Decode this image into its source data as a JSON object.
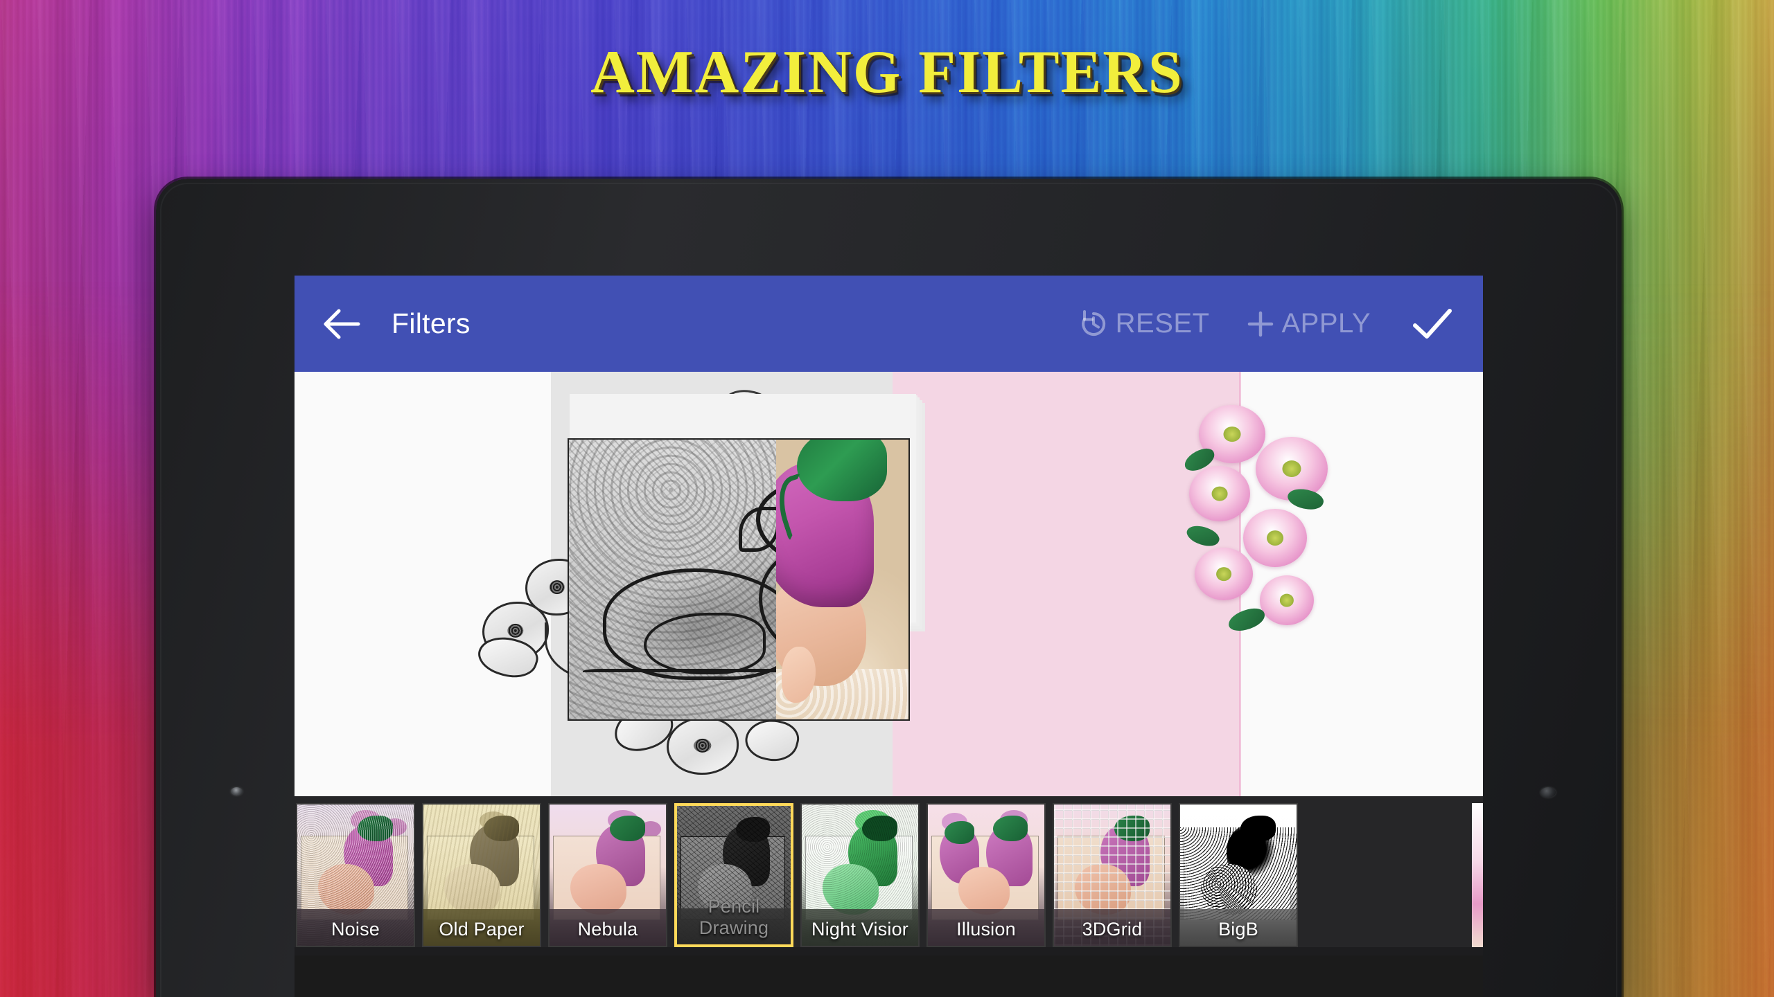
{
  "promo": {
    "headline": "AMAZING FILTERS",
    "headline_color": "#f2ee3c"
  },
  "device": {
    "type": "tablet",
    "front_camera_icon": "camera-dot-icon",
    "sensor_icon": "sensor-dot-icon"
  },
  "appbar": {
    "back_icon": "back-arrow-icon",
    "title": "Filters",
    "background_color": "#4150b4",
    "actions": [
      {
        "id": "reset",
        "label": "RESET",
        "icon": "history-restore-icon",
        "enabled": false
      },
      {
        "id": "apply",
        "label": "APPLY",
        "icon": "plus-icon",
        "enabled": false
      }
    ],
    "confirm": {
      "label": "",
      "icon": "checkmark-icon",
      "enabled": true
    }
  },
  "preview": {
    "description": "Split preview: pencil-sketch filtered half on the left, original colour photo on the right",
    "left_panel_color": "#fafafa",
    "mid_panel_color": "#e5e5e5",
    "pink_panel_color": "#f4d6e4",
    "right_panel_color": "#fafafa"
  },
  "filter_strip": {
    "selected_index": 3,
    "selected_border_color": "#ffd95a",
    "background_color": "#262628",
    "items": [
      {
        "label": "Noise",
        "selected": false
      },
      {
        "label": "Old Paper",
        "selected": false
      },
      {
        "label": "Nebula",
        "selected": false
      },
      {
        "label": "Pencil Drawing",
        "selected": true
      },
      {
        "label": "Night Visior",
        "selected": false
      },
      {
        "label": "Illusion",
        "selected": false
      },
      {
        "label": "3DGrid",
        "selected": false
      },
      {
        "label": "BigB",
        "selected": false
      }
    ]
  }
}
